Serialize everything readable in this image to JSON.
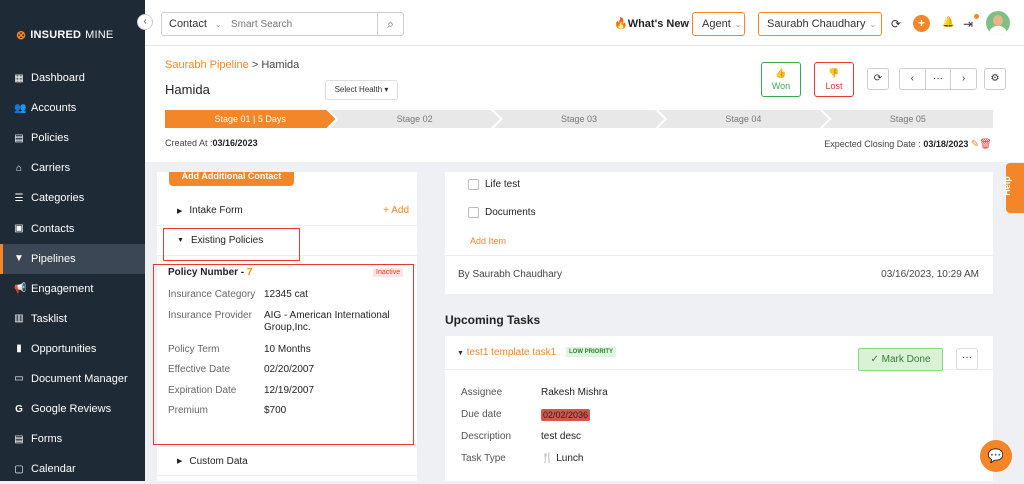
{
  "app": {
    "logo_text": "INSUREDMINE",
    "logo_bold": "INSURED",
    "logo_thin": "MINE"
  },
  "sidebar": {
    "items": [
      {
        "label": "Dashboard",
        "icon": "dashboard-icon"
      },
      {
        "label": "Accounts",
        "icon": "accounts-icon"
      },
      {
        "label": "Policies",
        "icon": "policies-icon"
      },
      {
        "label": "Carriers",
        "icon": "carriers-icon"
      },
      {
        "label": "Categories",
        "icon": "categories-icon"
      },
      {
        "label": "Contacts",
        "icon": "contacts-icon"
      },
      {
        "label": "Pipelines",
        "icon": "pipelines-icon",
        "active": true
      },
      {
        "label": "Engagement",
        "icon": "engagement-icon"
      },
      {
        "label": "Tasklist",
        "icon": "tasklist-icon"
      },
      {
        "label": "Opportunities",
        "icon": "opportunities-icon"
      },
      {
        "label": "Document Manager",
        "icon": "folder-icon"
      },
      {
        "label": "Google Reviews",
        "icon": "google-icon"
      },
      {
        "label": "Forms",
        "icon": "forms-icon"
      },
      {
        "label": "Calendar",
        "icon": "calendar-icon"
      }
    ]
  },
  "topbar": {
    "search_type": "Contact",
    "search_placeholder": "Smart Search",
    "whats_new": "What's New",
    "role": "Agent",
    "user": "Saurabh Chaudhary"
  },
  "header": {
    "breadcrumb_link": "Saurabh Pipeline",
    "breadcrumb_sep": " > ",
    "breadcrumb_current": "Hamida",
    "title": "Hamida",
    "select_health": "Select Health",
    "won": "Won",
    "lost": "Lost",
    "more_label": "···",
    "stages": [
      "Stage 01 | 5 Days",
      "Stage 02",
      "Stage 03",
      "Stage 04",
      "Stage 05"
    ],
    "created_label": "Created At :",
    "created_value": "03/16/2023",
    "expected_label": "Expected Closing Date :",
    "expected_value": "03/18/2023"
  },
  "help": "Help",
  "left_panel": {
    "add_contact": "Add Additional Contact",
    "intake_form": "Intake Form",
    "add": "+ Add",
    "existing_policies": "Existing Policies",
    "policy_number_label": "Policy Number - ",
    "policy_number": "7",
    "status": "Inactive",
    "fields": [
      {
        "label": "Insurance Category",
        "value": "12345 cat"
      },
      {
        "label": "Insurance Provider",
        "value": "AIG - American International",
        "value2": "Group,Inc."
      },
      {
        "label": "Policy Term",
        "value": "10 Months"
      },
      {
        "label": "Effective Date",
        "value": "02/20/2007"
      },
      {
        "label": "Expiration Date",
        "value": "12/19/2007"
      },
      {
        "label": "Premium",
        "value": "$700"
      }
    ],
    "custom_data": "Custom Data"
  },
  "right_panel": {
    "items": [
      "Life test",
      "Documents"
    ],
    "add_item": "Add Item",
    "by": "By Saurabh Chaudhary",
    "by_date": "03/16/2023, 10:29 AM"
  },
  "tasks": {
    "heading": "Upcoming Tasks",
    "title": "test1 template task1",
    "priority": "LOW PRIORITY",
    "mark_done": "Mark Done",
    "more": "···",
    "rows": [
      {
        "label": "Assignee",
        "value": "Rakesh Mishra"
      },
      {
        "label": "Due date",
        "value": "02/02/2036"
      },
      {
        "label": "Description",
        "value": "test desc"
      },
      {
        "label": "Task Type",
        "value": "Lunch"
      }
    ]
  },
  "colors": {
    "accent": "#f4862a",
    "sidebar": "#1f2a37",
    "won": "#3aa757",
    "lost": "#e53935",
    "highlight": "#e53935"
  }
}
